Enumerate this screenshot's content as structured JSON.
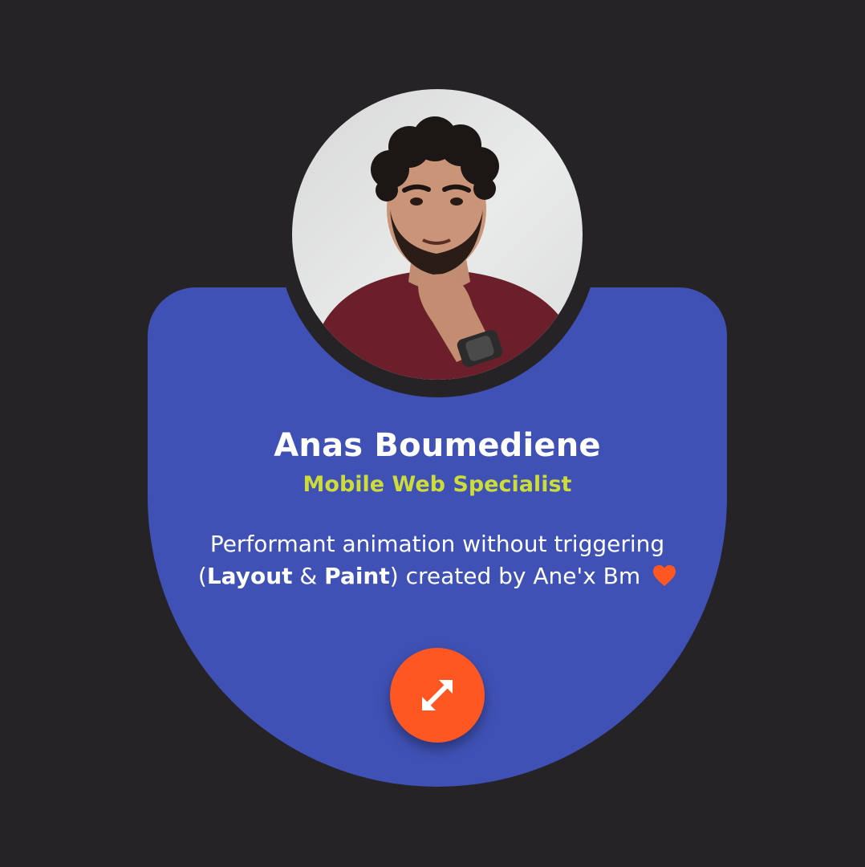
{
  "profile": {
    "name": "Anas Boumediene",
    "role": "Mobile Web Specialist",
    "description": {
      "part1": "Performant animation without triggering (",
      "layout": "Layout",
      "amp": " & ",
      "paint": "Paint",
      "part2": ") created by Ane'x Bm"
    },
    "heart_icon": "heart-icon",
    "expand_icon": "expand-arrows-icon"
  },
  "colors": {
    "background": "#252326",
    "card": "#3f51b5",
    "role": "#cddc39",
    "accent": "#ff5722"
  }
}
